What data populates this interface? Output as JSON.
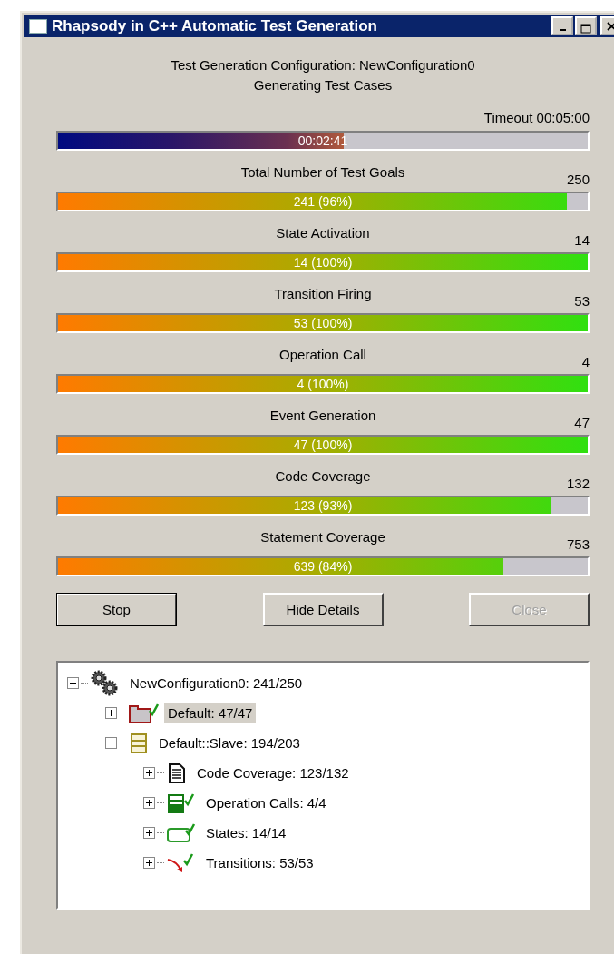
{
  "window": {
    "title": "Rhapsody in C++ Automatic Test Generation"
  },
  "header": {
    "configuration": "Test Generation Configuration: NewConfiguration0",
    "status": "Generating Test Cases"
  },
  "timeout": {
    "label": "Timeout 00:05:00",
    "elapsed": "00:02:41",
    "level": 0.54
  },
  "goals": [
    {
      "label": "Total Number of Test Goals",
      "total": "250",
      "reading": "241 (96%)",
      "level": 0.96
    },
    {
      "label": "State Activation",
      "total": "14",
      "reading": "14 (100%)",
      "level": 1
    },
    {
      "label": "Transition Firing",
      "total": "53",
      "reading": "53 (100%)",
      "level": 1
    },
    {
      "label": "Operation Call",
      "total": "4",
      "reading": "4 (100%)",
      "level": 1
    },
    {
      "label": "Event Generation",
      "total": "47",
      "reading": "47 (100%)",
      "level": 1
    },
    {
      "label": "Code Coverage",
      "total": "132",
      "reading": "123 (93%)",
      "level": 0.93
    },
    {
      "label": "Statement Coverage",
      "total": "753",
      "reading": "639 (84%)",
      "level": 0.84
    }
  ],
  "buttons": [
    {
      "label": "Stop",
      "disabled": false,
      "default": true
    },
    {
      "label": "Hide Details",
      "disabled": false,
      "default": false
    },
    {
      "label": "Close",
      "disabled": true,
      "default": false
    }
  ],
  "tree": [
    {
      "kind": "configuration",
      "label": "NewConfiguration0: 241/250",
      "expanded": true,
      "selected": false,
      "children": [
        {
          "kind": "package",
          "label": "Default: 47/47",
          "expanded": false,
          "selected": true
        },
        {
          "kind": "class",
          "label": "Default::Slave: 194/203",
          "expanded": true,
          "selected": false,
          "children": [
            {
              "kind": "code",
              "label": "Code Coverage: 123/132",
              "expanded": false,
              "selected": false
            },
            {
              "kind": "operation",
              "label": "Operation Calls: 4/4",
              "expanded": false,
              "selected": false
            },
            {
              "kind": "state",
              "label": "States: 14/14",
              "expanded": false,
              "selected": false
            },
            {
              "kind": "transition",
              "label": "Transitions: 53/53",
              "expanded": false,
              "selected": false
            }
          ]
        }
      ]
    }
  ]
}
